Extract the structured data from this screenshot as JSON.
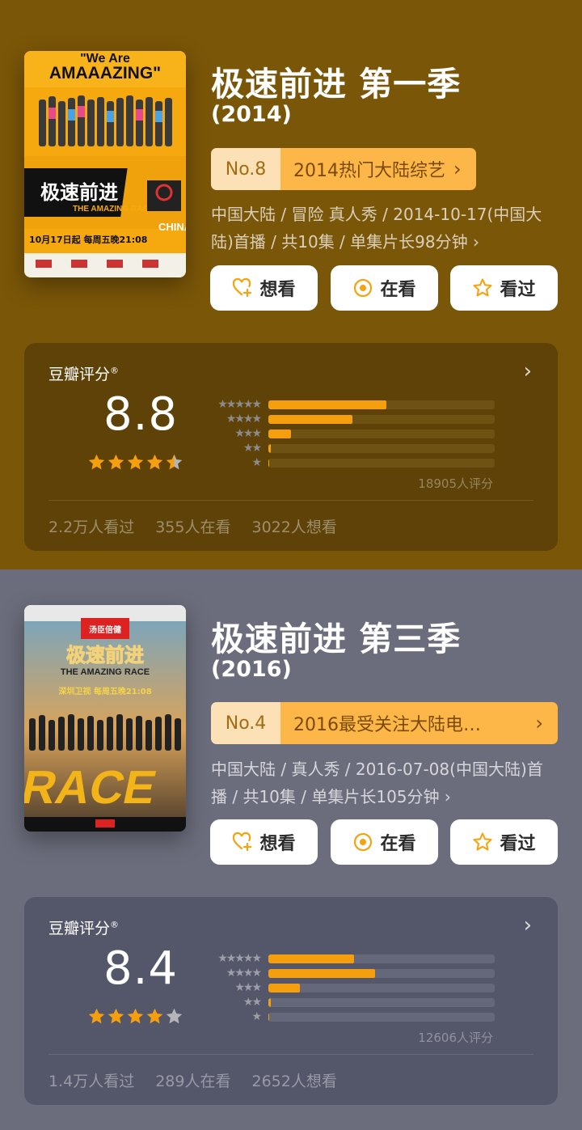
{
  "colors": {
    "season1_bg": "#7a5608",
    "season3_bg": "#6b6d7c",
    "accent": "#f59f0f"
  },
  "shows": [
    {
      "title": "极速前进 第一季",
      "year": "(2014)",
      "rank_no": "No.8",
      "rank_text": "2014热门大陆综艺",
      "meta": "中国大陆 / 冒险 真人秀 / 2014-10-17(中国大陆)首播 / 共10集 / 单集片长98分钟 ›",
      "poster": {
        "top_text": "\"We Are AMAAAZING\"",
        "logo_text": "极速前进",
        "country": "CHINA",
        "date_line": "10月17日起 每周五晚21:08"
      },
      "buttons": {
        "want": "想看",
        "watching": "在看",
        "watched": "看过"
      },
      "rating": {
        "label": "豆瓣评分",
        "score": "8.8",
        "stars": 4.5,
        "distribution_pct": [
          52,
          37,
          10,
          1,
          0.5
        ],
        "votes": "18905人评分",
        "stats": [
          "2.2万人看过",
          "355人在看",
          "3022人想看"
        ]
      }
    },
    {
      "title": "极速前进 第三季",
      "year": "(2016)",
      "rank_no": "No.4",
      "rank_text": "2016最受关注大陆电…",
      "meta": "中国大陆 / 真人秀 / 2016-07-08(中国大陆)首播 / 共10集 / 单集片长105分钟 ›",
      "poster": {
        "logo_text": "极速前进",
        "big_text": "RACE",
        "date_line": "深圳卫视 每周五晚21:08"
      },
      "buttons": {
        "want": "想看",
        "watching": "在看",
        "watched": "看过"
      },
      "rating": {
        "label": "豆瓣评分",
        "score": "8.4",
        "stars": 4,
        "distribution_pct": [
          38,
          47,
          14,
          1,
          0.5
        ],
        "votes": "12606人评分",
        "stats": [
          "1.4万人看过",
          "289人在看",
          "2652人想看"
        ]
      }
    }
  ]
}
